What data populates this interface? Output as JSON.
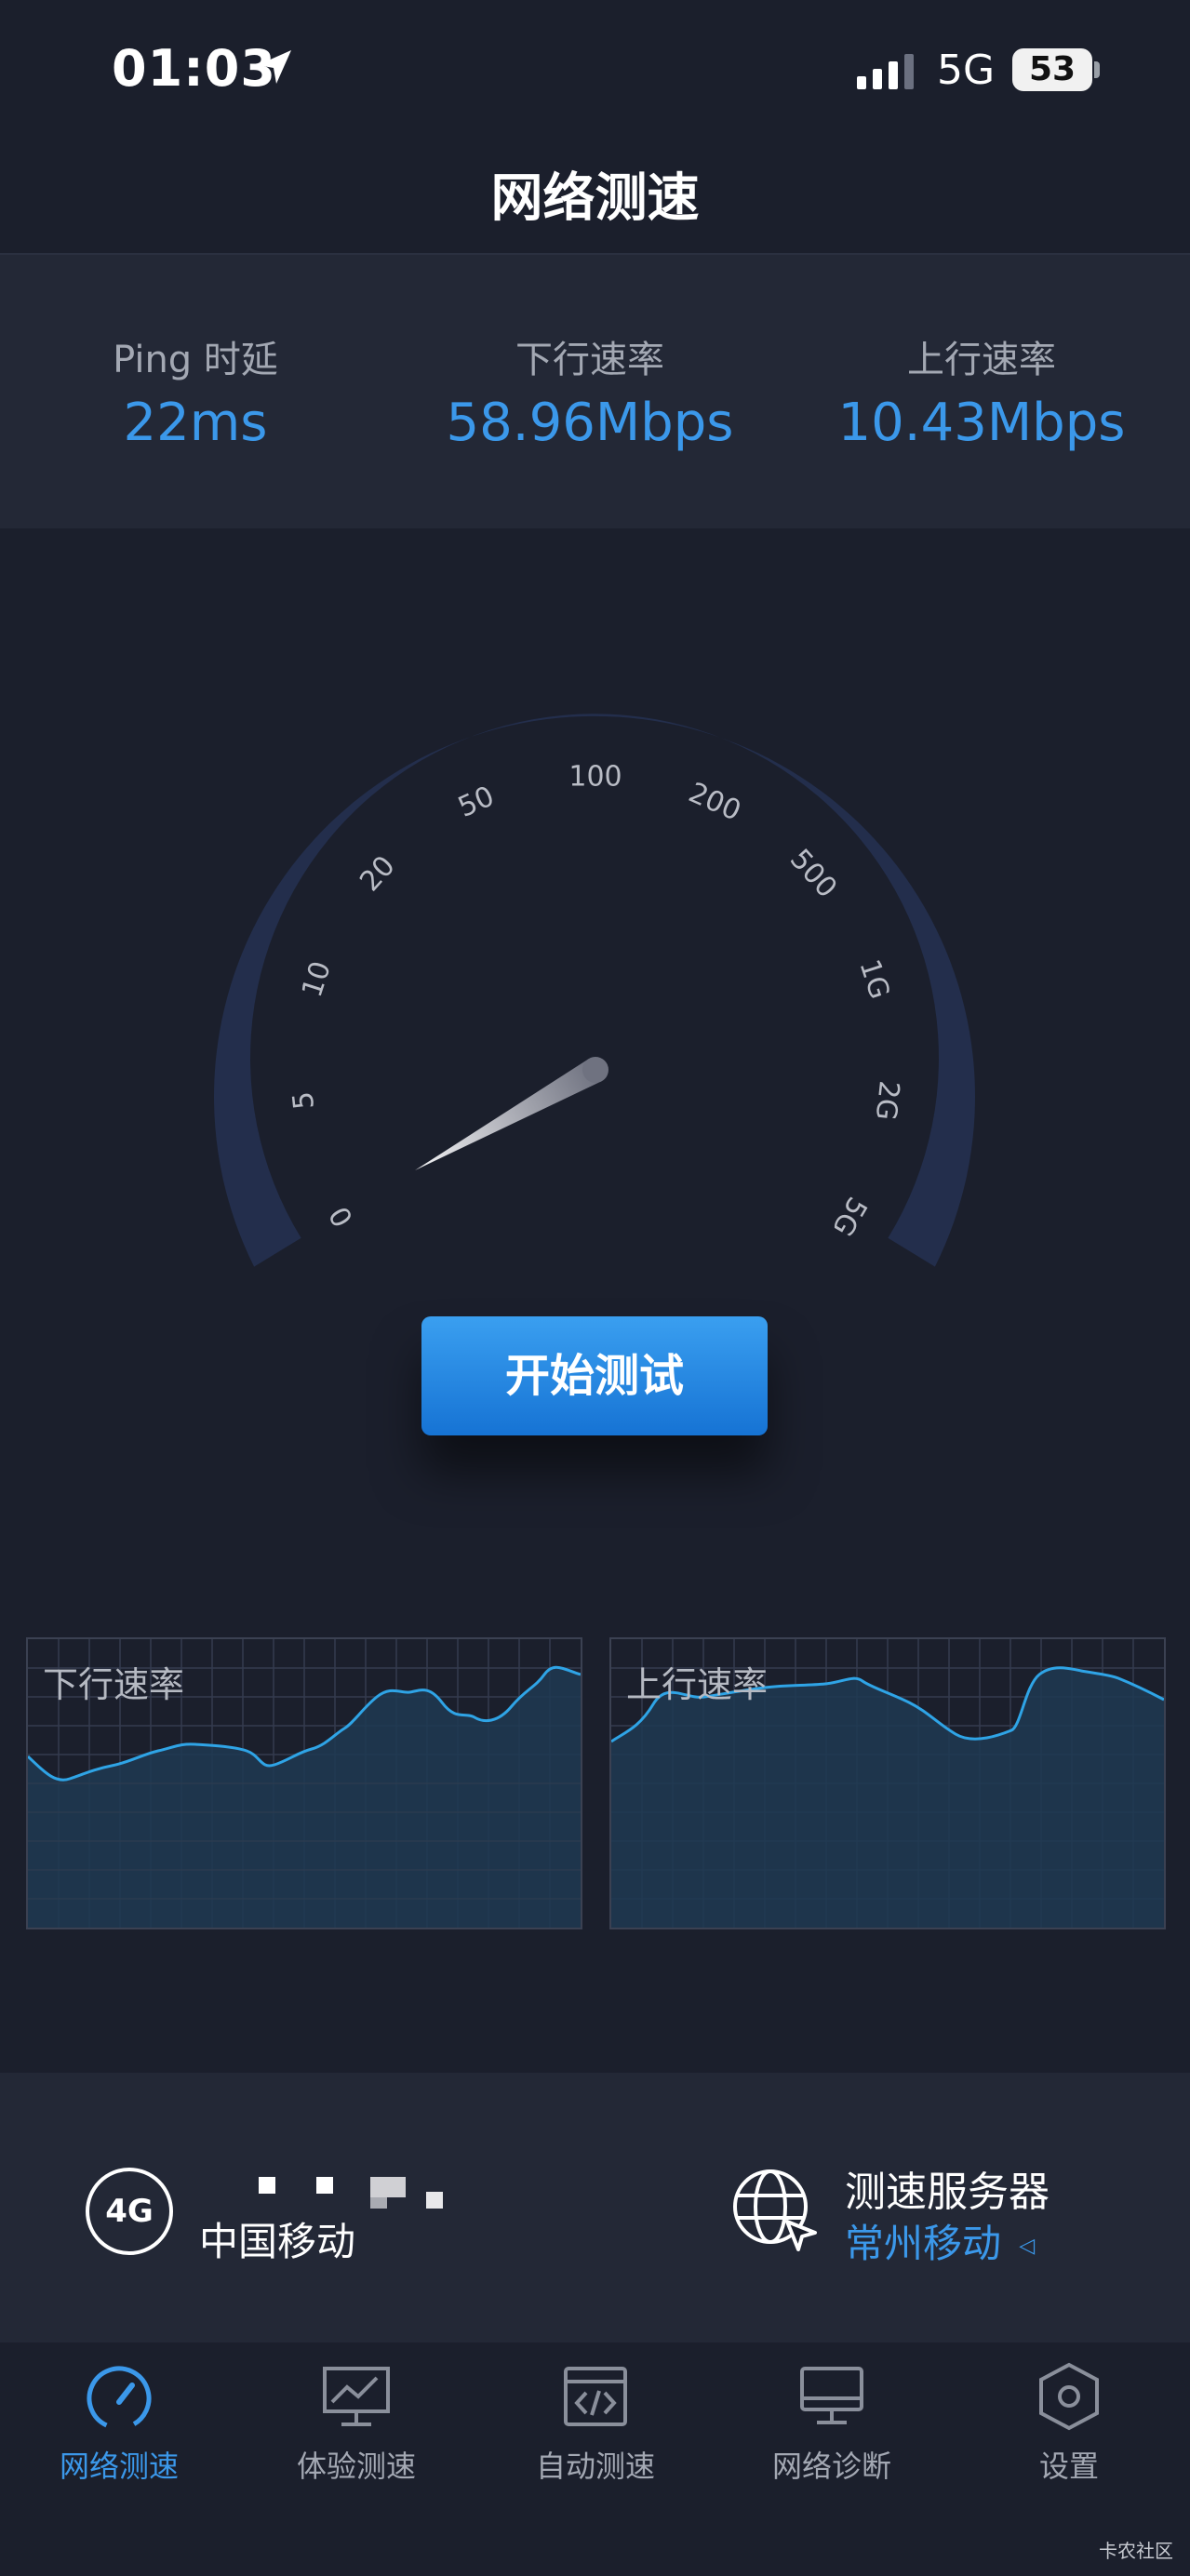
{
  "status_bar": {
    "time": "01:03",
    "network": "5G",
    "battery": "53"
  },
  "header": {
    "title": "网络测速"
  },
  "metrics": [
    {
      "label": "Ping 时延",
      "value": "22ms"
    },
    {
      "label": "下行速率",
      "value": "58.96Mbps"
    },
    {
      "label": "上行速率",
      "value": "10.43Mbps"
    }
  ],
  "gauge": {
    "ticks": [
      "0",
      "5",
      "10",
      "20",
      "50",
      "100",
      "200",
      "500",
      "1G",
      "2G",
      "5G"
    ]
  },
  "start_button": {
    "label": "开始测试"
  },
  "charts": {
    "download": {
      "label": "下行速率"
    },
    "upload": {
      "label": "上行速率"
    }
  },
  "connection": {
    "type": "4G",
    "carrier": "中国移动"
  },
  "server": {
    "label": "测速服务器",
    "value": "常州移动"
  },
  "tabs": [
    {
      "label": "网络测速",
      "icon": "speedometer-icon",
      "active": true
    },
    {
      "label": "体验测速",
      "icon": "chart-monitor-icon"
    },
    {
      "label": "自动测速",
      "icon": "code-window-icon"
    },
    {
      "label": "网络诊断",
      "icon": "monitor-icon"
    },
    {
      "label": "设置",
      "icon": "hexagon-gear-icon"
    }
  ],
  "watermark": "卡农社区",
  "colors": {
    "background": "#1b1f2c",
    "panel": "#232836",
    "accent": "#3b98ea",
    "gauge_track": "#232e4c"
  }
}
